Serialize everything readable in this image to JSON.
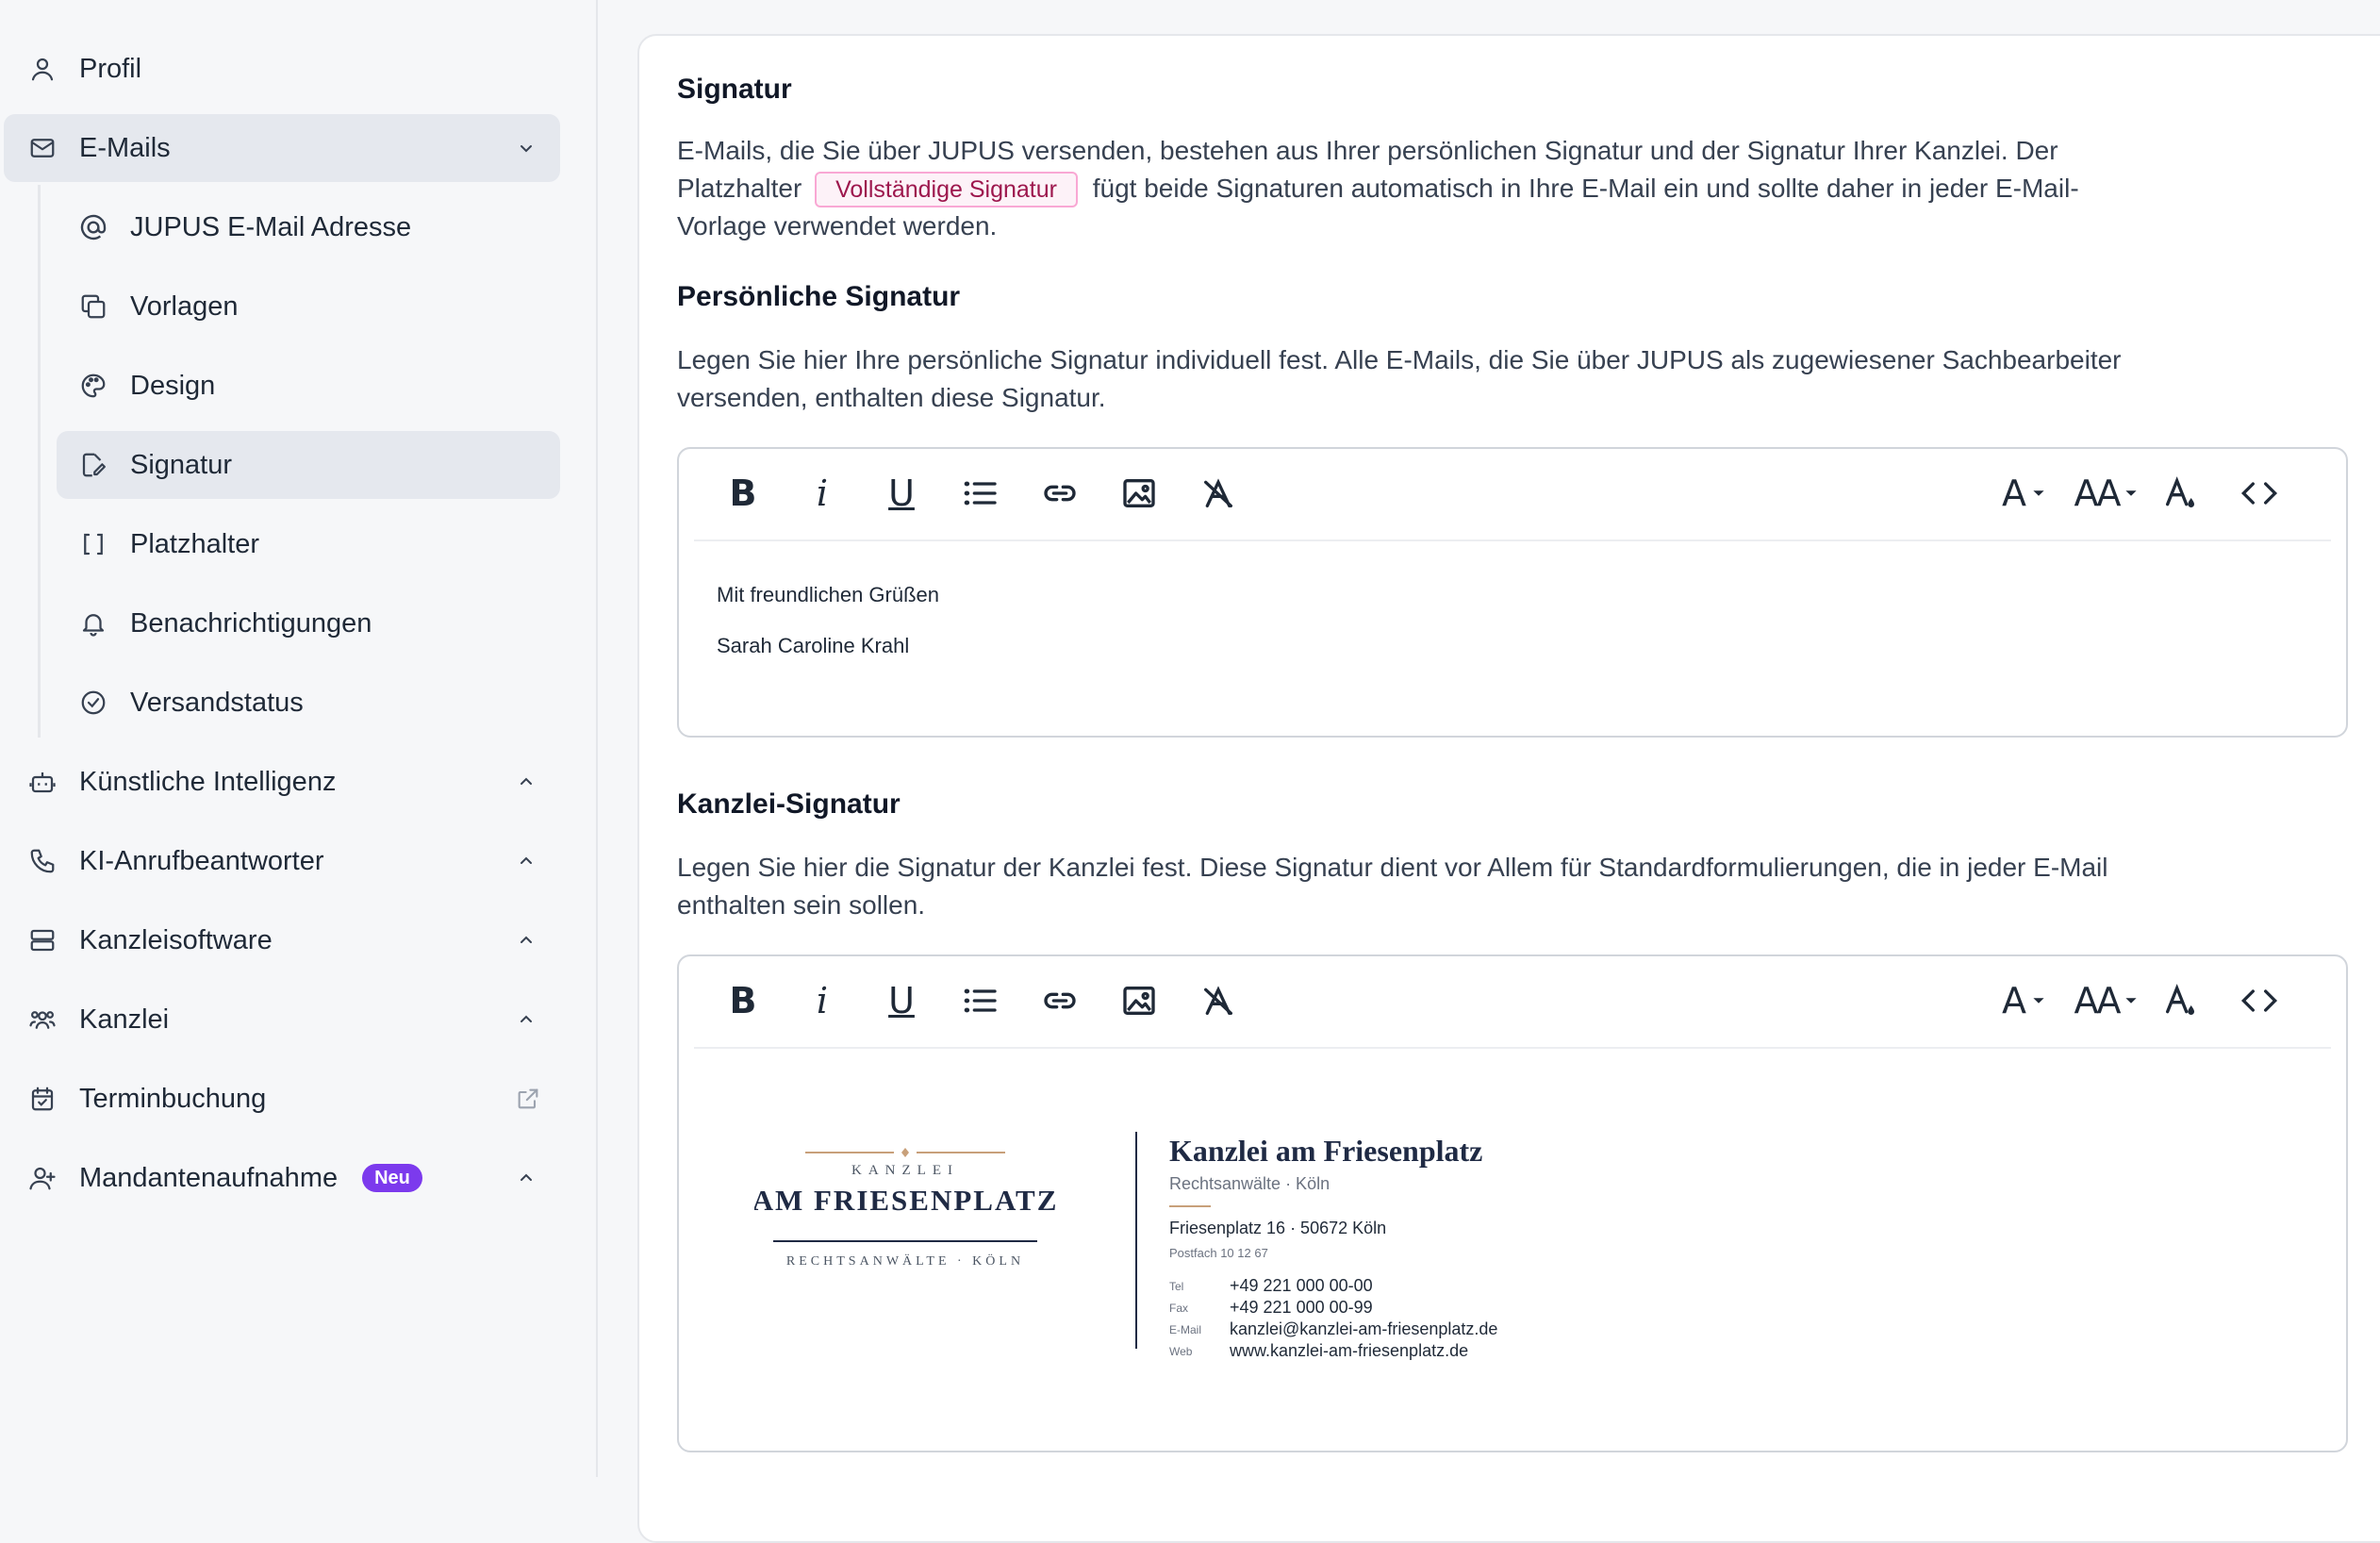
{
  "sidebar": {
    "items": [
      {
        "label": "Profil"
      },
      {
        "label": "E-Mails"
      },
      {
        "label": "JUPUS E-Mail Adresse"
      },
      {
        "label": "Vorlagen"
      },
      {
        "label": "Design"
      },
      {
        "label": "Signatur"
      },
      {
        "label": "Platzhalter"
      },
      {
        "label": "Benachrichtigungen"
      },
      {
        "label": "Versandstatus"
      },
      {
        "label": "Künstliche Intelligenz"
      },
      {
        "label": "KI-Anrufbeantworter"
      },
      {
        "label": "Kanzleisoftware"
      },
      {
        "label": "Kanzlei"
      },
      {
        "label": "Terminbuchung"
      },
      {
        "label": "Mandantenaufnahme",
        "badge": "Neu"
      }
    ],
    "active_item": "Signatur",
    "badge_color": "#7c3aed"
  },
  "signature": {
    "title": "Signatur",
    "intro_part1": "E-Mails, die Sie über JUPUS versenden, bestehen aus Ihrer persönlichen Signatur und der Signatur Ihrer Kanzlei. Der Platzhalter",
    "placeholder_pill": "Vollständige Signatur",
    "intro_part2": "fügt beide Signaturen automatisch in Ihre E-Mail ein und sollte daher in jeder E-Mail-Vorlage verwendet werden."
  },
  "personal": {
    "title": "Persönliche Signatur",
    "description": "Legen Sie hier Ihre persönliche Signatur individuell fest. Alle E-Mails, die Sie über JUPUS als zugewiesener Sachbearbeiter versenden, enthalten diese Signatur.",
    "content_lines": [
      "Mit freundlichen Grüßen",
      "Sarah Caroline Krahl"
    ]
  },
  "office": {
    "title": "Kanzlei-Signatur",
    "description": "Legen Sie hier die Signatur der Kanzlei fest. Diese Signatur dient vor Allem für Standardformulierungen, die in jeder E-Mail enthalten sein sollen.",
    "logo": {
      "top_text": "KANZLEI",
      "main_text": "AM FRIESENPLATZ",
      "bottom_text": "RECHTSANWÄLTE · KÖLN"
    },
    "sig": {
      "name": "Kanzlei am Friesenplatz",
      "subtitle": "Rechtsanwälte · Köln",
      "address": "Friesenplatz 16 · 50672 Köln",
      "postbox": "Postfach 10 12 67",
      "contacts": [
        {
          "key": "Tel",
          "value": "+49 221 000 00-00"
        },
        {
          "key": "Fax",
          "value": "+49 221 000 00-99"
        },
        {
          "key": "E-Mail",
          "value": "kanzlei@kanzlei-am-friesenplatz.de"
        },
        {
          "key": "Web",
          "value": "www.kanzlei-am-friesenplatz.de"
        }
      ]
    }
  },
  "toolbar": {
    "bold": "B",
    "italic": "i",
    "underline": "U",
    "font_family": "A",
    "font_size": "AA"
  },
  "colors": {
    "accent_pill_bg": "#fdf2f8",
    "accent_pill_text": "#9d174d",
    "brand_navy": "#1f2a44",
    "brand_gold": "#c8a07a"
  }
}
